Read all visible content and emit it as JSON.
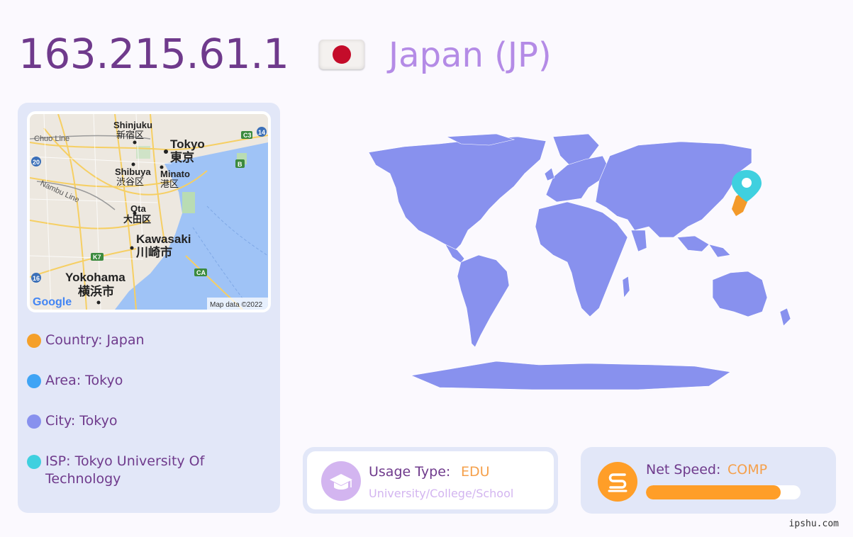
{
  "header": {
    "ip_address": "163.215.61.1",
    "country_title": "Japan (JP)",
    "flag_icon": "japan-flag-icon"
  },
  "map_card": {
    "labels": {
      "shinjuku": "Shinjuku",
      "shinjuku_jp": "新宿区",
      "chuo_line": "Chuo Line",
      "tokyo": "Tokyo",
      "tokyo_jp": "東京",
      "shibuya": "Shibuya",
      "shibuya_jp": "渋谷区",
      "minato": "Minato",
      "minato_jp": "港区",
      "nambu_line": "Nambu Line",
      "ota": "Ota",
      "ota_jp": "大田区",
      "kawasaki": "Kawasaki",
      "kawasaki_jp": "川崎市",
      "yokohama": "Yokohama",
      "yokohama_jp": "横浜市",
      "road_c3": "C3",
      "road_14": "14",
      "road_20": "20",
      "road_b": "B",
      "road_k7": "K7",
      "road_ca": "CA",
      "road_16": "16"
    },
    "attribution": "Map data ©2022",
    "logo": "Google"
  },
  "info": [
    {
      "text": "Country: Japan",
      "color": "#f5a02a"
    },
    {
      "text": "Area: Tokyo",
      "color": "#3fa4f5"
    },
    {
      "text": "City: Tokyo",
      "color": "#8891ee"
    },
    {
      "text": "ISP: Tokyo University Of Technology",
      "color": "#3fd0df"
    }
  ],
  "world_map": {
    "land_color": "#8891ee",
    "highlight_color": "#f39a2a",
    "pin_color": "#3fd0df",
    "pin_icon": "map-pin-icon"
  },
  "usage": {
    "label": "Usage Type:",
    "value": "EDU",
    "description": "University/College/School",
    "icon": "graduation-cap-icon",
    "icon_color": "#d3b5f0"
  },
  "speed": {
    "label": "Net Speed:",
    "value": "COMP",
    "icon": "speed-s-icon",
    "icon_color": "#ff9e28",
    "level_percent": 87
  },
  "brand": "ipshu.com"
}
